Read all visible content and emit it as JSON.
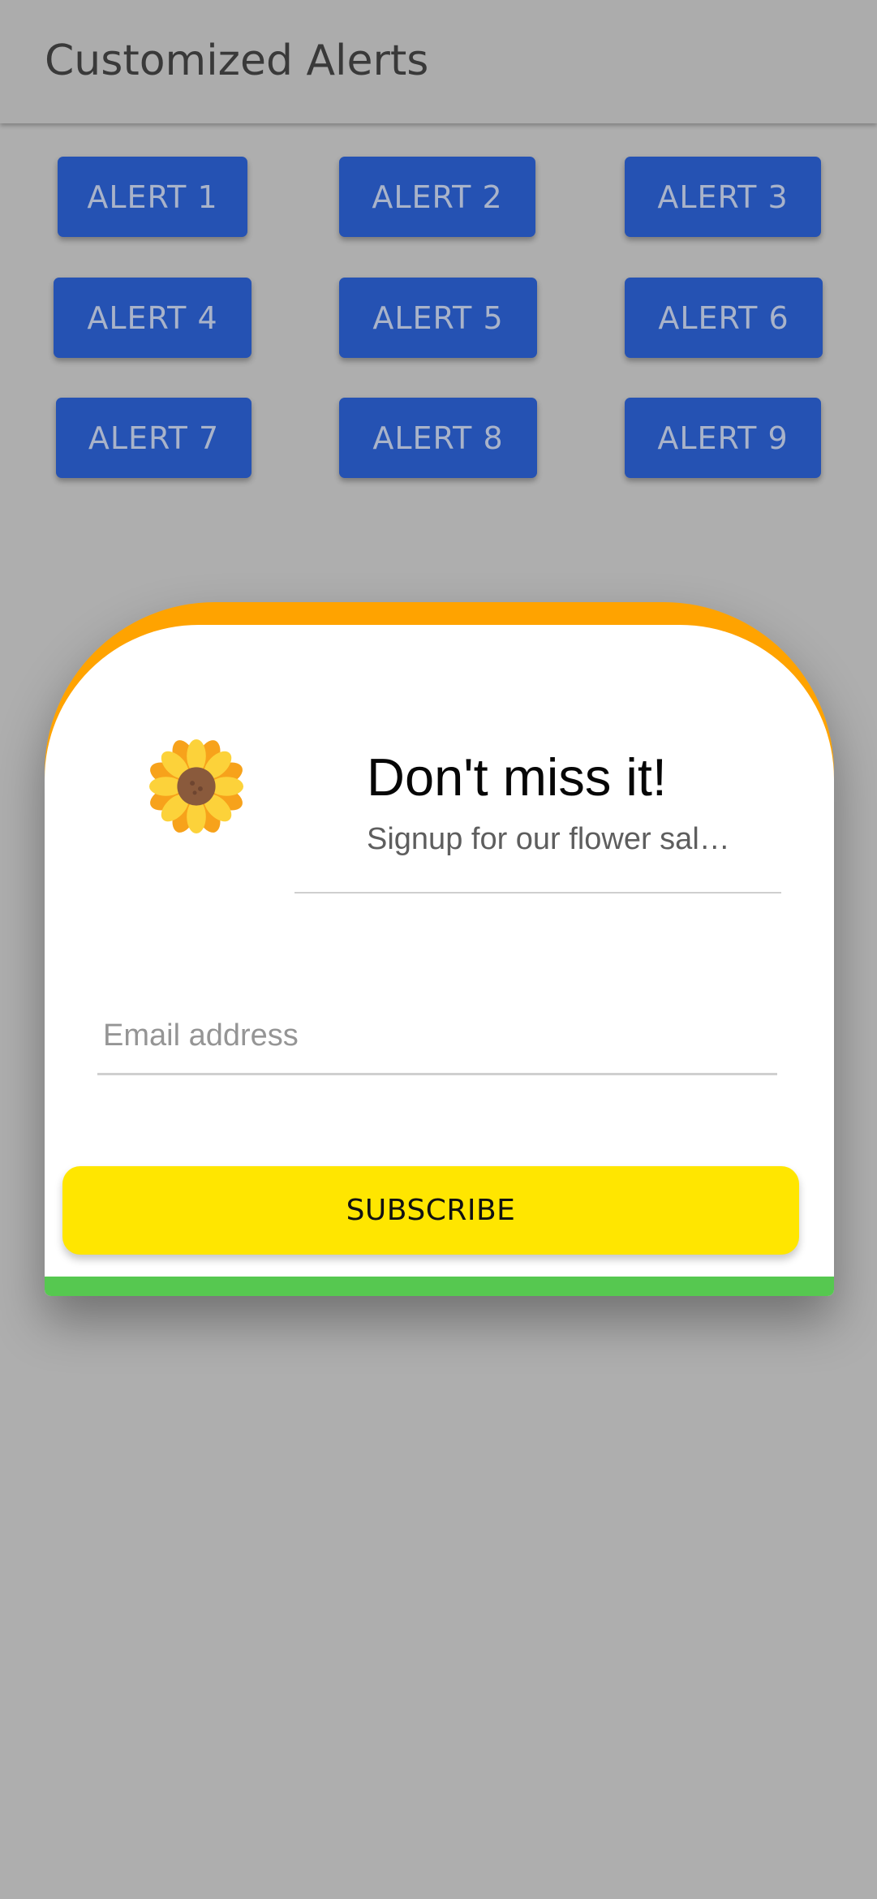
{
  "appbar": {
    "title": "Customized Alerts"
  },
  "alerts": [
    {
      "label": "ALERT 1"
    },
    {
      "label": "ALERT 2"
    },
    {
      "label": "ALERT 3"
    },
    {
      "label": "ALERT 4"
    },
    {
      "label": "ALERT 5"
    },
    {
      "label": "ALERT 6"
    },
    {
      "label": "ALERT 7"
    },
    {
      "label": "ALERT 8"
    },
    {
      "label": "ALERT 9"
    }
  ],
  "dialog": {
    "icon": "sunflower-icon",
    "title": "Don't miss it!",
    "subtitle": "Signup for our flower sal…",
    "email": {
      "placeholder": "Email address",
      "value": ""
    },
    "subscribe_label": "SUBSCRIBE"
  },
  "colors": {
    "background_overlay": "#aeaeae",
    "alert_button": "#2552b3",
    "dialog_top_accent": "#ffa300",
    "dialog_bottom_accent": "#56c850",
    "subscribe_button": "#ffe600"
  }
}
